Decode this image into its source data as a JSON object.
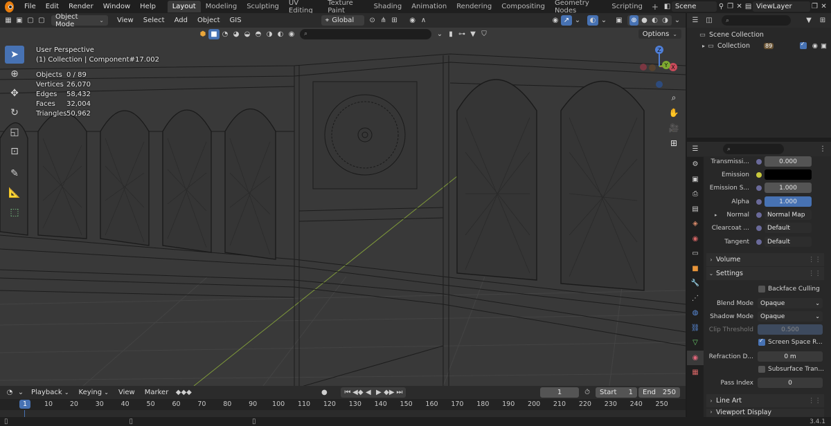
{
  "menu": [
    "File",
    "Edit",
    "Render",
    "Window",
    "Help"
  ],
  "workspaces": [
    {
      "label": "Layout",
      "active": true
    },
    {
      "label": "Modeling"
    },
    {
      "label": "Sculpting"
    },
    {
      "label": "UV Editing"
    },
    {
      "label": "Texture Paint"
    },
    {
      "label": "Shading"
    },
    {
      "label": "Animation"
    },
    {
      "label": "Rendering"
    },
    {
      "label": "Compositing"
    },
    {
      "label": "Geometry Nodes"
    },
    {
      "label": "Scripting"
    }
  ],
  "scene": "Scene",
  "view_layer": "ViewLayer",
  "viewport": {
    "mode": "Object Mode",
    "menus": [
      "View",
      "Select",
      "Add",
      "Object",
      "GIS"
    ],
    "transform_orientation": "Global",
    "options_label": "Options",
    "perspective_label": "User Perspective",
    "collection_label": "(1) Collection | Component#17.002",
    "stats": [
      {
        "label": "Objects",
        "value": "0 / 89"
      },
      {
        "label": "Vertices",
        "value": "26,070"
      },
      {
        "label": "Edges",
        "value": "58,432"
      },
      {
        "label": "Faces",
        "value": "32,004"
      },
      {
        "label": "Triangles",
        "value": "50,962"
      }
    ],
    "gizmo": {
      "z": "Z",
      "y": "Y",
      "x": "X"
    }
  },
  "outliner": {
    "scene_collection": "Scene Collection",
    "collection": "Collection",
    "collection_count": "89"
  },
  "properties": {
    "rows": [
      {
        "label": "Transmissi...",
        "value": "0.000",
        "kind": "num"
      },
      {
        "label": "Emission",
        "value": "",
        "kind": "color"
      },
      {
        "label": "Emission S...",
        "value": "1.000",
        "kind": "num"
      },
      {
        "label": "Alpha",
        "value": "1.000",
        "kind": "blue"
      },
      {
        "label": "Normal",
        "value": "Normal Map",
        "kind": "link"
      },
      {
        "label": "Clearcoat ...",
        "value": "Default",
        "kind": "link"
      },
      {
        "label": "Tangent",
        "value": "Default",
        "kind": "link"
      }
    ],
    "sections": {
      "volume": "Volume",
      "settings": "Settings",
      "line_art": "Line Art",
      "viewport_display": "Viewport Display"
    },
    "settings": {
      "backface_culling": "Backface Culling",
      "blend_mode_label": "Blend Mode",
      "blend_mode": "Opaque",
      "shadow_mode_label": "Shadow Mode",
      "shadow_mode": "Opaque",
      "clip_threshold_label": "Clip Threshold",
      "clip_threshold": "0.500",
      "screen_space_refraction": "Screen Space R...",
      "refraction_depth_label": "Refraction D...",
      "refraction_depth": "0 m",
      "subsurface_translucency": "Subsurface Tran...",
      "pass_index_label": "Pass Index",
      "pass_index": "0"
    }
  },
  "timeline": {
    "menus": [
      "Playback",
      "Keying",
      "View",
      "Marker"
    ],
    "current_frame": "1",
    "start_label": "Start",
    "start": "1",
    "end_label": "End",
    "end": "250",
    "ticks": [
      "10",
      "20",
      "30",
      "40",
      "50",
      "60",
      "70",
      "80",
      "90",
      "100",
      "110",
      "120",
      "130",
      "140",
      "150",
      "160",
      "170",
      "180",
      "190",
      "200",
      "210",
      "220",
      "230",
      "240",
      "250"
    ],
    "ruler_current": "1"
  },
  "version": "3.4.1",
  "colors": {
    "accent": "#4772b3",
    "viewport_bg": "#393939",
    "panel_bg": "#282828"
  }
}
